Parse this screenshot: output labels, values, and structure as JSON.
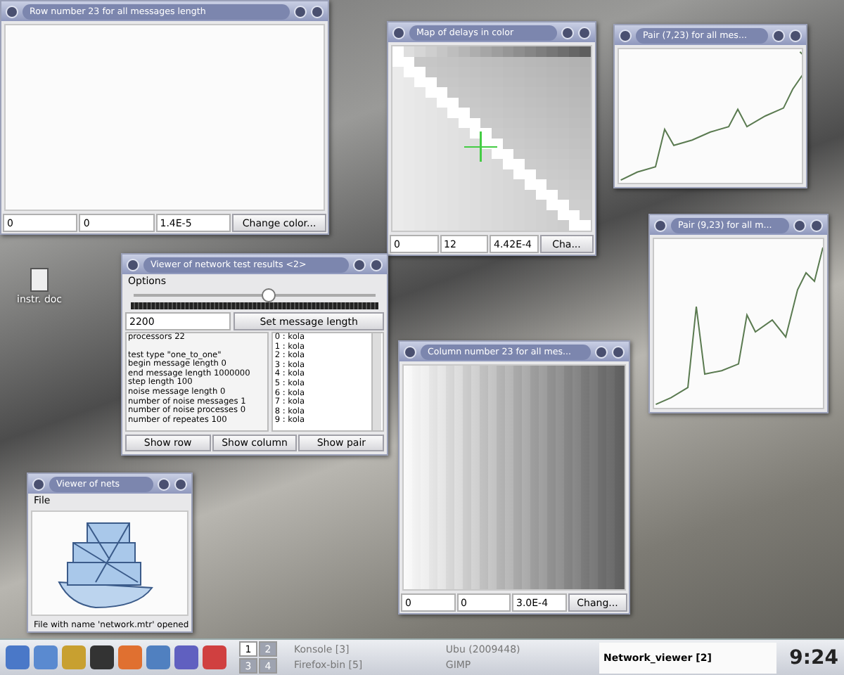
{
  "desktop": {
    "icons": [
      {
        "label": "instr. doc"
      }
    ]
  },
  "row_window": {
    "title": "Row number 23 for all messages length",
    "fields": [
      "0",
      "0",
      "1.4E-5"
    ],
    "button": "Change color..."
  },
  "map_window": {
    "title": "Map of delays in color",
    "fields": [
      "0",
      "12",
      "4.42E-4"
    ],
    "button": "Cha..."
  },
  "pair_windows": [
    {
      "title": "Pair (7,23) for all mes..."
    },
    {
      "title": "Pair (9,23) for all m..."
    }
  ],
  "viewer_window": {
    "title": "Viewer of network test results <2>",
    "menu": "Options",
    "slider": {
      "level": 0.55
    },
    "length_field": {
      "value": "2200"
    },
    "set_button": "Set message length",
    "info": [
      "processors 22",
      "test type \"one_to_one\"",
      "begin message length 0",
      "end message length 1000000",
      "step length 100",
      "noise message length 0",
      "number of noise messages 1",
      "number of noise processes 0",
      "number of repeates 100"
    ],
    "hosts": [
      {
        "label": "0 : kola",
        "selected": false
      },
      {
        "label": "1 : kola",
        "selected": false
      },
      {
        "label": "2 : kola",
        "selected": false
      },
      {
        "label": "3 : kola",
        "selected": false
      },
      {
        "label": "4 : kola",
        "selected": false
      },
      {
        "label": "5 : kola",
        "selected": false
      },
      {
        "label": "6 : kola",
        "selected": false
      },
      {
        "label": "7 : kola",
        "selected": false
      },
      {
        "label": "8 : kola",
        "selected": false
      },
      {
        "label": "9 : kola",
        "selected": false
      }
    ],
    "buttons": [
      "Show row",
      "Show column",
      "Show pair"
    ]
  },
  "column_window": {
    "title": "Column number 23 for all mes...",
    "fields": [
      "0",
      "0",
      "3.0E-4"
    ],
    "button": "Chang..."
  },
  "nets_window": {
    "title": "Viewer of nets",
    "menu": "File",
    "status": "File with name 'network.mtr' opened"
  },
  "taskbar": {
    "pager": [
      {
        "label": "1",
        "selected": true
      },
      {
        "label": "2",
        "selected": false
      },
      {
        "label": "3",
        "selected": false
      },
      {
        "label": "4",
        "selected": false
      }
    ],
    "tasks": [
      {
        "label": "Konsole [3]",
        "selected": false
      },
      {
        "label": "Firefox-bin [5]",
        "selected": false
      },
      {
        "label": "Ubu (2009448)",
        "selected": false
      },
      {
        "label": "GIMP",
        "selected": false
      },
      {
        "label": "Network_viewer [2]",
        "selected": true
      }
    ],
    "clock": "9:24"
  }
}
